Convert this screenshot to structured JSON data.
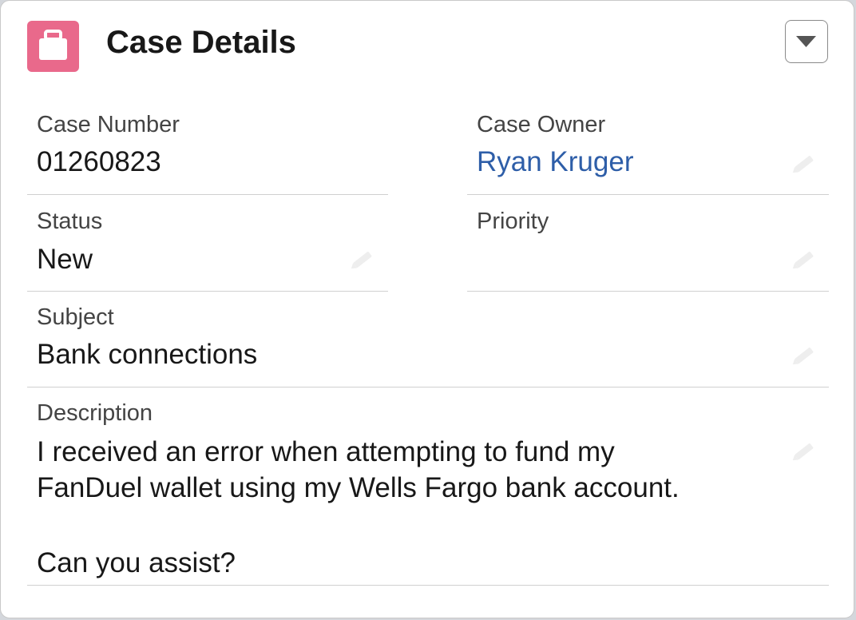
{
  "card": {
    "title": "Case Details",
    "header_icon": "briefcase-icon",
    "menu_icon": "chevron-down-icon",
    "icon_color": "#e9698b",
    "link_color": "#2e5ea8"
  },
  "fields": {
    "case_number": {
      "label": "Case Number",
      "value": "01260823"
    },
    "case_owner": {
      "label": "Case Owner",
      "value": "Ryan Kruger"
    },
    "status": {
      "label": "Status",
      "value": "New"
    },
    "priority": {
      "label": "Priority",
      "value": ""
    },
    "subject": {
      "label": "Subject",
      "value": "Bank connections"
    },
    "description": {
      "label": "Description",
      "line1": "I received an error when attempting to fund my",
      "line2": "FanDuel wallet using my Wells Fargo bank account.",
      "line3": "Can you assist?"
    }
  },
  "edit_icon": "pencil-icon"
}
